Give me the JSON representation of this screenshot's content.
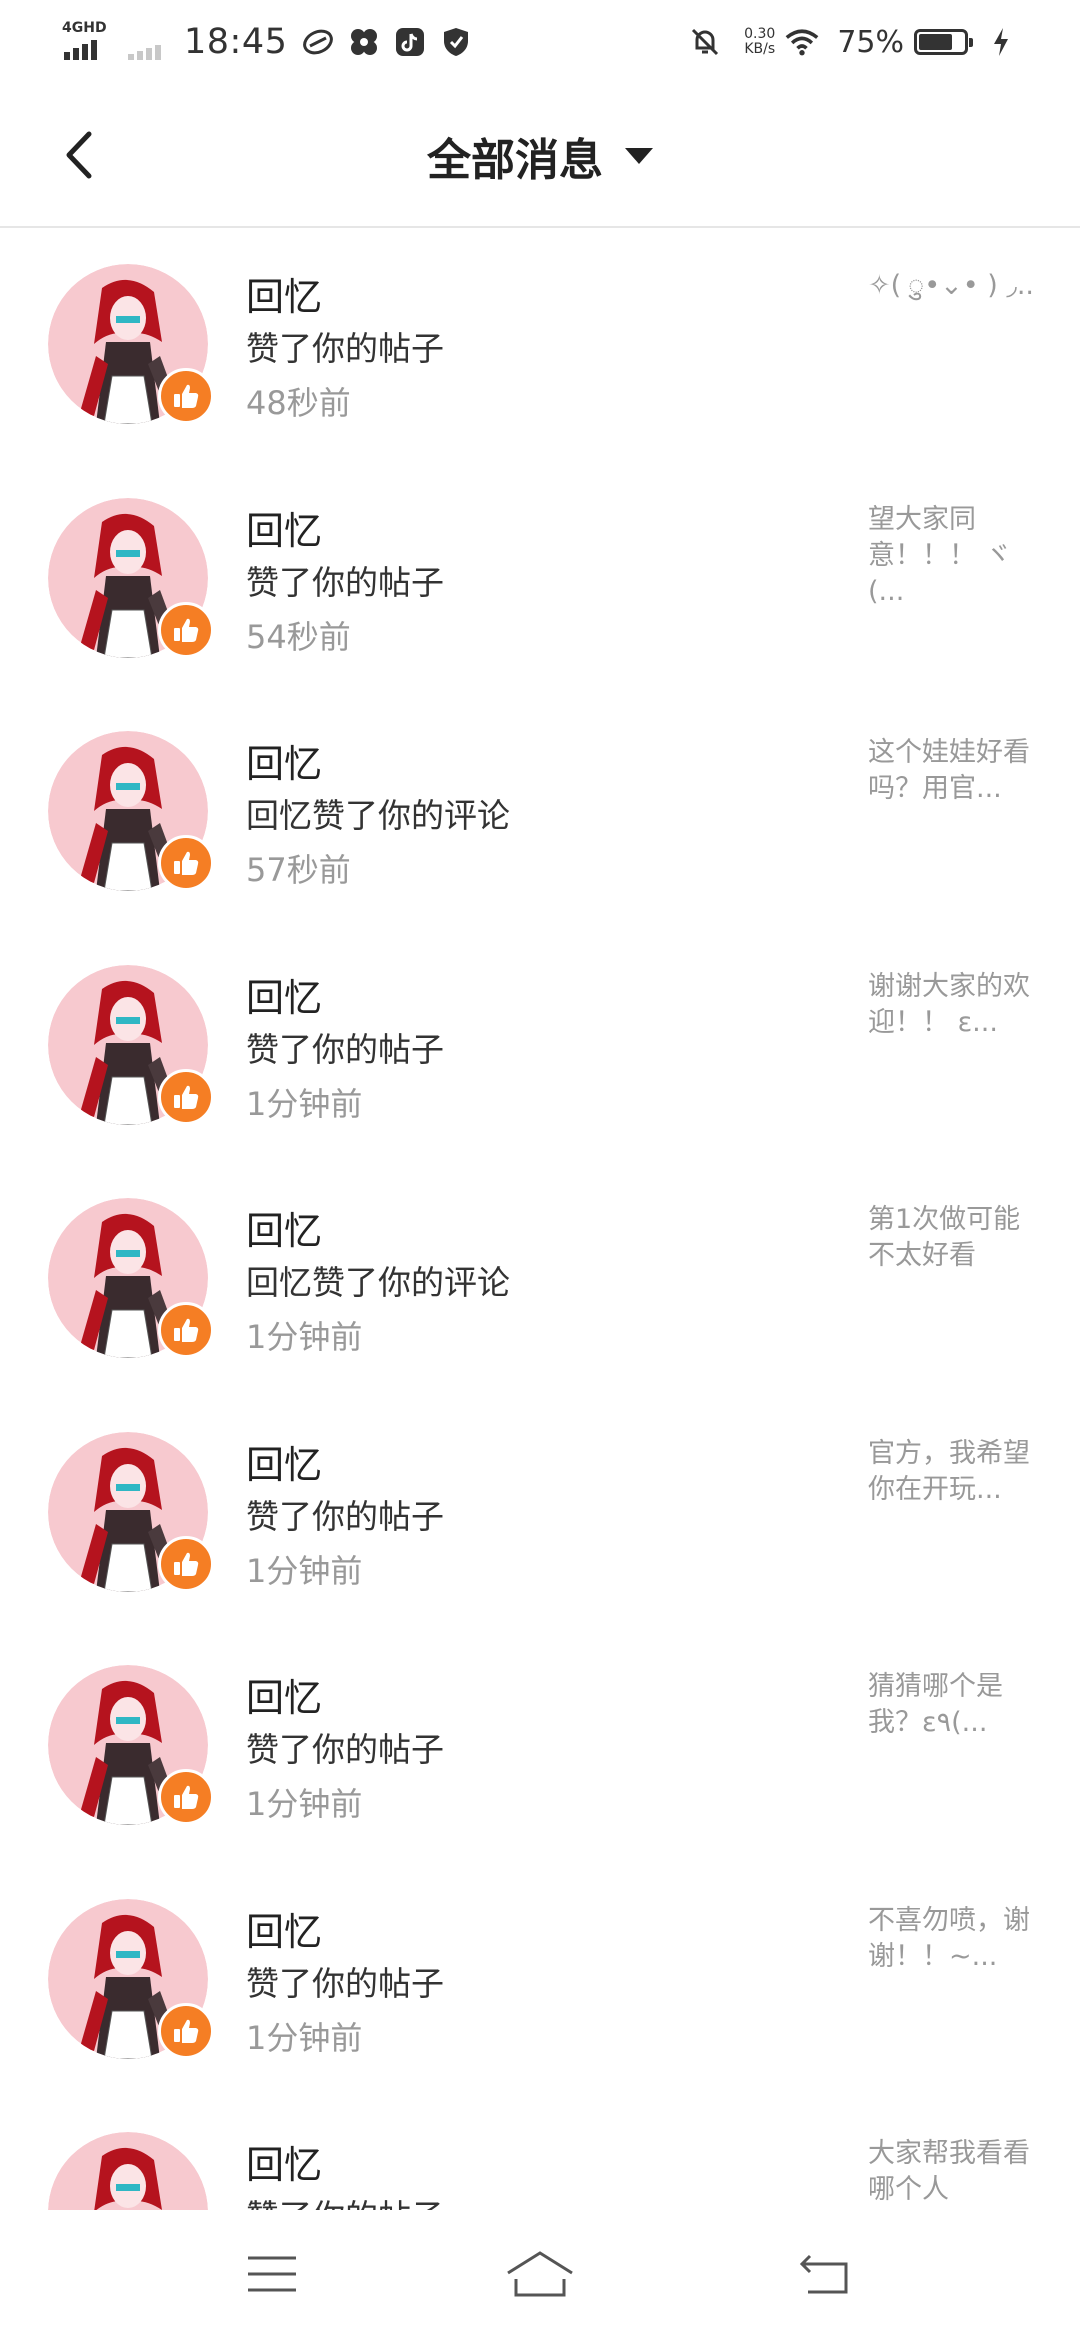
{
  "status_bar": {
    "network_type": "4GHD",
    "time": "18:45",
    "speed_value": "0.30",
    "speed_unit": "KB/s",
    "battery_percent": "75%",
    "battery_level": 0.75
  },
  "header": {
    "title": "全部消息",
    "dropdown_icon": "caret-down-icon",
    "back_icon": "chevron-left-icon"
  },
  "colors": {
    "like_badge": "#f57e24",
    "avatar_bg": "#f7c9cf",
    "secondary_text": "#999999"
  },
  "messages": [
    {
      "name": "回忆",
      "action": "赞了你的帖子",
      "time": "48秒前",
      "preview": "✧( ु•⌄• ) ◞.."
    },
    {
      "name": "回忆",
      "action": "赞了你的帖子",
      "time": "54秒前",
      "preview": "望大家同意！！！ ヾ(..."
    },
    {
      "name": "回忆",
      "action": "回忆赞了你的评论",
      "time": "57秒前",
      "preview": "这个娃娃好看吗？用官..."
    },
    {
      "name": "回忆",
      "action": "赞了你的帖子",
      "time": "1分钟前",
      "preview": "谢谢大家的欢迎！！ ε..."
    },
    {
      "name": "回忆",
      "action": "回忆赞了你的评论",
      "time": "1分钟前",
      "preview": "第1次做可能不太好看"
    },
    {
      "name": "回忆",
      "action": "赞了你的帖子",
      "time": "1分钟前",
      "preview": "官方，我希望你在开玩..."
    },
    {
      "name": "回忆",
      "action": "赞了你的帖子",
      "time": "1分钟前",
      "preview": "猜猜哪个是我？ε٩(..."
    },
    {
      "name": "回忆",
      "action": "赞了你的帖子",
      "time": "1分钟前",
      "preview": "不喜勿喷，谢谢！！~..."
    },
    {
      "name": "回忆",
      "action": "赞了你的帖子",
      "time": "",
      "preview": "大家帮我看看哪个人"
    }
  ],
  "nav_bar": {
    "menu_icon": "menu-icon",
    "home_icon": "home-icon",
    "back_icon": "back-icon"
  }
}
